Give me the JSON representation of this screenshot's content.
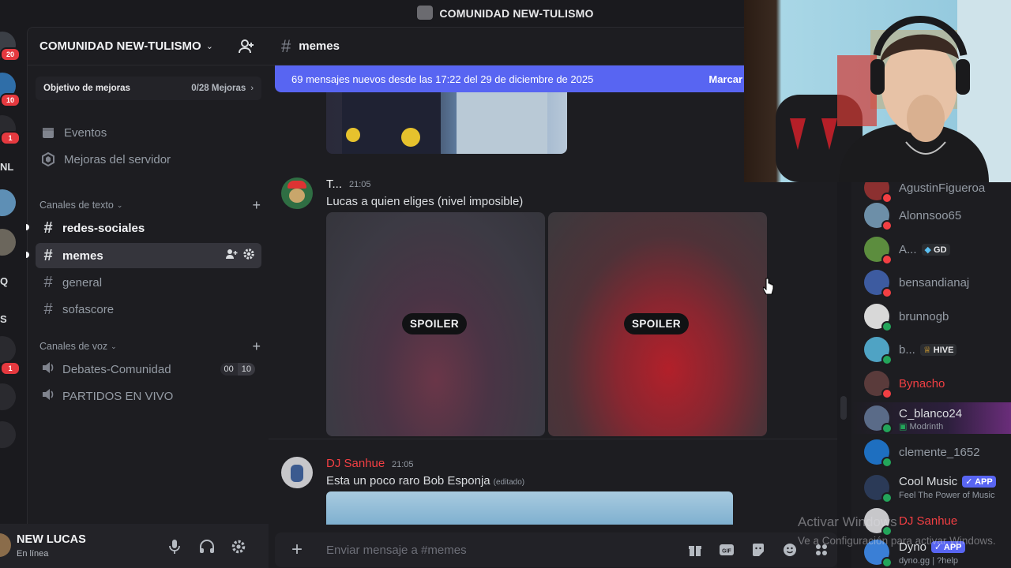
{
  "window": {
    "title": "COMUNIDAD NEW-TULISMO"
  },
  "rail": {
    "badges": [
      "20",
      "10",
      "1",
      "1"
    ],
    "letters": [
      "NL",
      "Q",
      "S"
    ]
  },
  "server": {
    "name": "COMUNIDAD NEW-TULISMO",
    "boost_goal": "Objetivo de mejoras",
    "boost_count": "0/28 Mejoras"
  },
  "nav": {
    "events": "Eventos",
    "boosts": "Mejoras del servidor"
  },
  "text_section": "Canales de texto",
  "text_channels": [
    {
      "name": "redes-sociales"
    },
    {
      "name": "memes"
    },
    {
      "name": "general"
    },
    {
      "name": "sofascore"
    }
  ],
  "voice_section": "Canales de voz",
  "voice_channels": [
    {
      "name": "Debates-Comunidad",
      "count_a": "00",
      "count_b": "10"
    },
    {
      "name": "PARTIDOS EN VIVO"
    }
  ],
  "user": {
    "name": "NEW LUCAS",
    "status": "En línea"
  },
  "chat": {
    "channel": "memes",
    "new_messages": "69 mensajes nuevos desde las 17:22 del 29 de diciembre de 2025",
    "mark_read": "Marcar",
    "messages": [
      {
        "author": "T...",
        "time": "21:05",
        "text": "Lucas a quien eliges (nivel imposible)",
        "spoiler_label": "SPOILER"
      },
      {
        "author": "DJ Sanhue",
        "time": "21:05",
        "text": "Esta un poco raro Bob Esponja",
        "edited": "(editado)"
      }
    ],
    "composer_placeholder": "Enviar mensaje a #memes"
  },
  "members": [
    {
      "name": "AgustinFigueroa"
    },
    {
      "name": "Alonnsoo65"
    },
    {
      "name": "A...",
      "tag": "GD"
    },
    {
      "name": "bensandianaj"
    },
    {
      "name": "brunnogb"
    },
    {
      "name": "b...",
      "tag": "HIVE"
    },
    {
      "name": "Bynacho"
    },
    {
      "name": "C_blanco24",
      "sub": "Modrinth"
    },
    {
      "name": "clemente_1652"
    },
    {
      "name": "Cool Music",
      "tag": "APP",
      "sub": "Feel The Power of Music"
    },
    {
      "name": "DJ Sanhue"
    },
    {
      "name": "Dyno",
      "tag": "APP",
      "sub": "dyno.gg | ?help"
    }
  ],
  "watermark": {
    "line1": "Activar Windows",
    "line2": "Ve a Configuración para activar Windows."
  },
  "colors": {
    "accent": "#5865f2",
    "online": "#23a55a",
    "dnd": "#f23f43",
    "red_name": "#f23f43"
  }
}
